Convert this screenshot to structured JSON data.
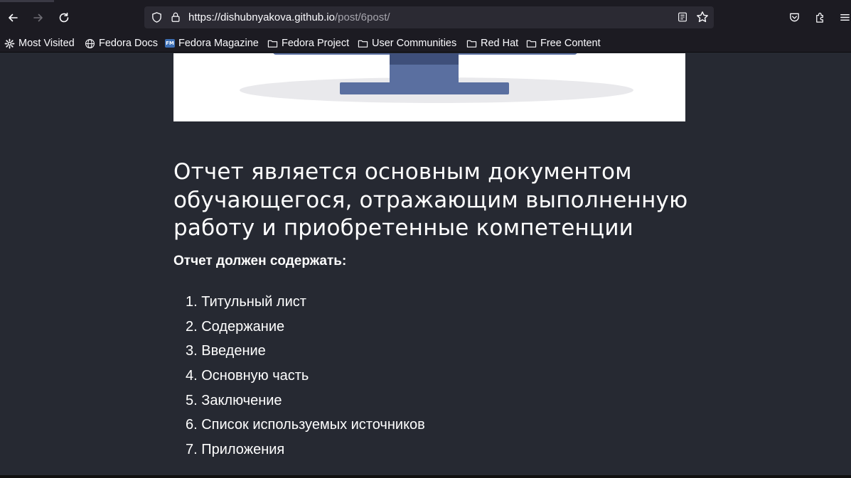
{
  "browser": {
    "url_host": "https://dishubnyakova.github.io",
    "url_path": "/post/6post/",
    "icons": [
      "back-arrow-icon",
      "forward-arrow-icon",
      "reload-icon",
      "shield-icon",
      "lock-icon",
      "reader-view-icon",
      "bookmark-star-icon",
      "pocket-icon",
      "extensions-icon",
      "menu-icon"
    ]
  },
  "bookmarks": [
    {
      "label": "Most Visited",
      "icon": "gear-icon"
    },
    {
      "label": "Fedora Docs",
      "icon": "globe-icon"
    },
    {
      "label": "Fedora Magazine",
      "icon": "fm-favicon"
    },
    {
      "label": "Fedora Project",
      "icon": "folder-icon"
    },
    {
      "label": "User Communities",
      "icon": "folder-icon"
    },
    {
      "label": "Red Hat",
      "icon": "folder-icon"
    },
    {
      "label": "Free Content",
      "icon": "folder-icon"
    }
  ],
  "favicon_text": "FM",
  "article": {
    "heading": "Отчет является основным документом обучающегося, отражающим выполненную работу и приобретенные компетенции",
    "subheading": "Отчет должен содержать:",
    "items": [
      "1. Титульный лист",
      "2. Содержание",
      "3. Введение",
      "4. Основную часть",
      "5. Заключение",
      "6. Список используемых источников",
      "7. Приложения"
    ]
  },
  "colors": {
    "page_bg": "#262932",
    "chrome_bg": "#1c1b22",
    "urlbar_bg": "#2b2a33",
    "monitor_blue": "#5a6fa0"
  }
}
